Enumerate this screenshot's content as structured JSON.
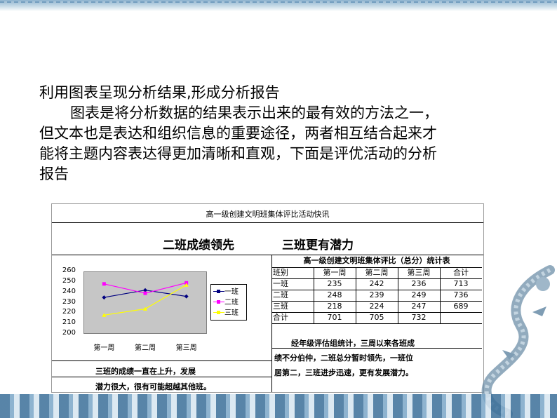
{
  "intro": {
    "title": "利用图表呈现分析结果,形成分析报告",
    "para_line1": "图表是将分析数据的结果表示出来的最有效的方法之一，",
    "para_line2": "但文本也是表达和组织信息的重要途径，两者相互结合起来才",
    "para_line3": "能将主题内容表达得更加清晰和直观，下面是评优活动的分析",
    "para_line4": "报告"
  },
  "sheet": {
    "title": "高一级创建文明班集体评比活动快讯",
    "headline_left": "二班成绩领先",
    "headline_right": "三班更有潜力",
    "table_title": "高一级创建文明班集体评比（总分）统计表",
    "table_header": [
      "班别",
      "第一周",
      "第二周",
      "第三周",
      "合计"
    ],
    "table_rows": [
      [
        "一班",
        "235",
        "242",
        "236",
        "713"
      ],
      [
        "二班",
        "248",
        "239",
        "249",
        "736"
      ],
      [
        "三班",
        "218",
        "224",
        "247",
        "689"
      ],
      [
        "合计",
        "701",
        "705",
        "732",
        ""
      ]
    ],
    "comment_right_line1": "经年级评估组统计，三周以来各班成",
    "comment_right_line2": "绩不分伯仲，二班总分暂时领先，一班位",
    "comment_right_line3": "居第二，三班进步迅速，更有发展潜力。",
    "comment_left_line1": "三班的成绩一直在上升，发展",
    "comment_left_line2": "潜力很大，很有可能超越其他班。"
  },
  "chart_data": {
    "type": "line",
    "categories": [
      "第一周",
      "第二周",
      "第三周"
    ],
    "series": [
      {
        "name": "一班",
        "values": [
          235,
          242,
          236
        ],
        "color": "#000080"
      },
      {
        "name": "二班",
        "values": [
          248,
          239,
          249
        ],
        "color": "#ff00ff"
      },
      {
        "name": "三班",
        "values": [
          218,
          224,
          247
        ],
        "color": "#ffff00"
      }
    ],
    "ylim": [
      200,
      260
    ],
    "yticks": [
      "260",
      "250",
      "240",
      "230",
      "220",
      "210",
      "200"
    ],
    "grid": false,
    "legend": "right",
    "background": "#c0c0c0"
  }
}
